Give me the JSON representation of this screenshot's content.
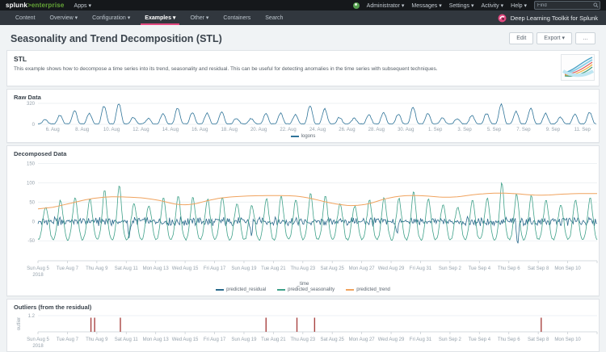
{
  "topbar": {
    "logo_main": "splunk",
    "logo_suffix": ">enterprise",
    "apps_menu": "Apps ▾",
    "user_menu": "Administrator ▾",
    "messages_menu": "Messages ▾",
    "settings_menu": "Settings ▾",
    "activity_menu": "Activity ▾",
    "help_menu": "Help ▾",
    "find_placeholder": "Find"
  },
  "appnav": {
    "items": [
      {
        "label": "Content",
        "active": false
      },
      {
        "label": "Overview ▾",
        "active": false
      },
      {
        "label": "Configuration ▾",
        "active": false
      },
      {
        "label": "Examples ▾",
        "active": true
      },
      {
        "label": "Other ▾",
        "active": false
      },
      {
        "label": "Containers",
        "active": false
      },
      {
        "label": "Search",
        "active": false
      }
    ],
    "app_title": "Deep Learning Toolkit for Splunk"
  },
  "header": {
    "title": "Seasonality and Trend Decomposition (STL)",
    "edit_label": "Edit",
    "export_label": "Export ▾",
    "more_label": "…"
  },
  "description_panel": {
    "title": "STL",
    "text": "This example shows how to decompose a time series into its trend, seasonality and residual. This can be useful for detecting anomalies in the time series with subsequent techniques."
  },
  "colors": {
    "accent_pink": "#e1477e",
    "logo_green": "#65a637",
    "raw_line": "#2f7499",
    "residual_line": "#2a6a8c",
    "seasonality_line": "#3fa189",
    "trend_line": "#f0a35e",
    "outlier_bar": "#a94442"
  },
  "chart_data": [
    {
      "type": "line",
      "title": "Raw Data",
      "ylim": [
        0,
        320
      ],
      "yticks": [
        320,
        0
      ],
      "xticklabels": [
        "6. Aug",
        "8. Aug",
        "10. Aug",
        "12. Aug",
        "14. Aug",
        "16. Aug",
        "18. Aug",
        "20. Aug",
        "22. Aug",
        "24. Aug",
        "26. Aug",
        "28. Aug",
        "30. Aug",
        "1. Sep",
        "3. Sep",
        "5. Sep",
        "7. Sep",
        "9. Sep",
        "11. Sep"
      ],
      "x_domain_days": 38,
      "x_start": "Aug 5 2018",
      "series": [
        {
          "name": "logons",
          "color": "#2f7499",
          "daily_peaks": [
            55,
            120,
            190,
            150,
            260,
            300,
            90,
            70,
            150,
            230,
            160,
            150,
            170,
            80,
            70,
            140,
            150,
            130,
            270,
            220,
            90,
            75,
            130,
            160,
            140,
            240,
            150,
            80,
            70,
            120,
            150,
            290,
            180,
            230,
            150,
            90,
            140,
            160
          ]
        }
      ],
      "legend_position": "bottom"
    },
    {
      "type": "line",
      "title": "Decomposed Data",
      "xlabel": "_time",
      "ylim": [
        -85,
        155
      ],
      "yticks": [
        150,
        100,
        50,
        0,
        -50
      ],
      "xticklabels": [
        "Sun Aug 5",
        "Tue Aug 7",
        "Thu Aug 9",
        "Sat Aug 11",
        "Mon Aug 13",
        "Wed Aug 15",
        "Fri Aug 17",
        "Sun Aug 19",
        "Tue Aug 21",
        "Thu Aug 23",
        "Sat Aug 25",
        "Mon Aug 27",
        "Wed Aug 29",
        "Fri Aug 31",
        "Sun Sep 2",
        "Tue Sep 4",
        "Thu Sep 6",
        "Sat Sep 8",
        "Mon Sep 10"
      ],
      "xticklabel_sub": "2018",
      "x_domain_days": 38,
      "series": [
        {
          "name": "predicted_residual",
          "color": "#2a6a8c",
          "noise_amplitude": 16,
          "spikes": [
            {
              "day": 6.2,
              "value": -45
            },
            {
              "day": 14.5,
              "value": -32
            },
            {
              "day": 24.4,
              "value": -30
            },
            {
              "day": 32.6,
              "value": -80
            }
          ]
        },
        {
          "name": "predicted_seasonality",
          "color": "#3fa189",
          "trough": -47,
          "daily_amplitude": [
            38,
            55,
            62,
            58,
            80,
            95,
            48,
            40,
            60,
            68,
            62,
            58,
            64,
            45,
            40,
            60,
            64,
            58,
            72,
            68,
            45,
            40,
            55,
            62,
            60,
            78,
            58,
            42,
            38,
            55,
            60,
            100,
            70,
            66,
            55,
            42,
            56,
            60
          ]
        },
        {
          "name": "predicted_trend",
          "color": "#f0a35e",
          "points_every_2_days": [
            28,
            45,
            63,
            64,
            58,
            37,
            60,
            66,
            67,
            66,
            45,
            38,
            65,
            68,
            60,
            72,
            74,
            66,
            72
          ]
        }
      ],
      "legend_position": "bottom"
    },
    {
      "type": "bar",
      "title": "Outliers (from the residual)",
      "ylabel": "outlier",
      "ylim": [
        0,
        1.2
      ],
      "yticks": [
        1.2
      ],
      "xticklabels": [
        "Sun Aug 5",
        "Tue Aug 7",
        "Thu Aug 9",
        "Sat Aug 11",
        "Mon Aug 13",
        "Wed Aug 15",
        "Fri Aug 17",
        "Sun Aug 19",
        "Tue Aug 21",
        "Thu Aug 23",
        "Sat Aug 25",
        "Mon Aug 27",
        "Wed Aug 29",
        "Fri Aug 31",
        "Sun Sep 2",
        "Tue Sep 4",
        "Thu Sep 6",
        "Sat Sep 8",
        "Mon Sep 10"
      ],
      "xticklabel_sub": "2018",
      "x_domain_days": 38,
      "bar_color": "#a94442",
      "bars": [
        {
          "day": 3.6,
          "value": 1.05
        },
        {
          "day": 3.85,
          "value": 1.05
        },
        {
          "day": 5.6,
          "value": 1.05
        },
        {
          "day": 15.5,
          "value": 1.05
        },
        {
          "day": 17.6,
          "value": 1.05
        },
        {
          "day": 18.8,
          "value": 1.05
        },
        {
          "day": 34.2,
          "value": 1.05
        }
      ]
    }
  ]
}
